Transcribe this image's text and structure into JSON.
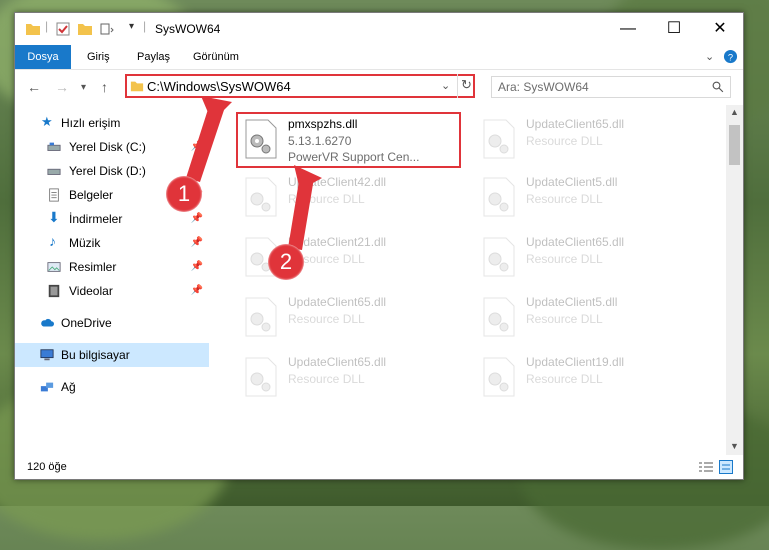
{
  "window": {
    "title": "SysWOW64"
  },
  "ribbon": {
    "tabs": [
      "Dosya",
      "Giriş",
      "Paylaş",
      "Görünüm"
    ]
  },
  "nav": {
    "address": "C:\\Windows\\SysWOW64",
    "search_placeholder": "Ara: SysWOW64"
  },
  "sidebar": {
    "items": [
      {
        "label": "Hızlı erişim",
        "icon": "star-icon"
      },
      {
        "label": "Yerel Disk (C:)",
        "icon": "drive-icon",
        "pinned": true
      },
      {
        "label": "Yerel Disk (D:)",
        "icon": "drive-icon",
        "pinned": true
      },
      {
        "label": "Belgeler",
        "icon": "documents-icon",
        "pinned": true
      },
      {
        "label": "İndirmeler",
        "icon": "download-icon",
        "pinned": true
      },
      {
        "label": "Müzik",
        "icon": "music-icon",
        "pinned": true
      },
      {
        "label": "Resimler",
        "icon": "pictures-icon",
        "pinned": true
      },
      {
        "label": "Videolar",
        "icon": "video-icon",
        "pinned": true
      },
      {
        "label": "OneDrive",
        "icon": "cloud-icon"
      },
      {
        "label": "Bu bilgisayar",
        "icon": "computer-icon",
        "selected": true
      },
      {
        "label": "Ağ",
        "icon": "network-icon"
      }
    ]
  },
  "files": [
    {
      "name": "pmxspzhs.dll",
      "line2": "5.13.1.6270",
      "line3": "PowerVR Support Cen..."
    },
    {
      "name": "UpdateClient65.dll",
      "line2": "Resource DLL"
    },
    {
      "name": "UpdateClient42.dll",
      "line2": "Resource DLL"
    },
    {
      "name": "UpdateClient5.dll",
      "line2": "Resource DLL"
    },
    {
      "name": "UpdateClient21.dll",
      "line2": "Resource DLL"
    },
    {
      "name": "UpdateClient65.dll",
      "line2": "Resource DLL"
    },
    {
      "name": "UpdateClient65.dll",
      "line2": "Resource DLL"
    },
    {
      "name": "UpdateClient5.dll",
      "line2": "Resource DLL"
    },
    {
      "name": "UpdateClient65.dll",
      "line2": "Resource DLL"
    },
    {
      "name": "UpdateClient19.dll",
      "line2": "Resource DLL"
    }
  ],
  "status": {
    "count": "120 öğe"
  },
  "annotations": {
    "badge1": "1",
    "badge2": "2"
  },
  "colors": {
    "accent": "#1979ca",
    "highlight": "#e0343a",
    "selected": "#cce8ff"
  }
}
